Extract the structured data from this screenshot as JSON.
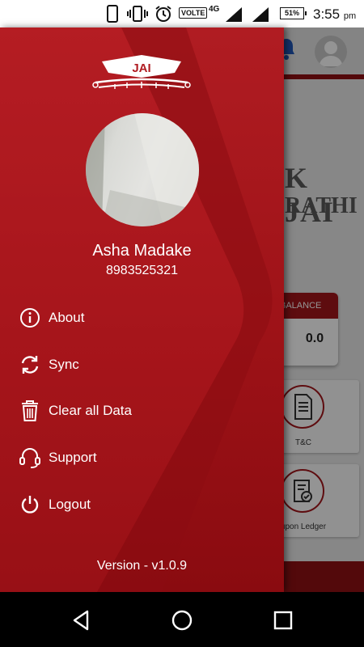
{
  "status_bar": {
    "volte": "VOLTE",
    "network": "4G",
    "battery": "51%",
    "time": "3:55",
    "ampm": "pm",
    "icons": [
      "phone-icon",
      "vibrate-icon",
      "alarm-icon",
      "signal-icon",
      "signal-icon-2"
    ]
  },
  "background_app": {
    "brand_line1": "K JAI",
    "brand_line2": "RATHI",
    "balance_label": "BALANCE",
    "balance_value": "0.0",
    "tiles": [
      {
        "label": "T&C",
        "icon": "document-icon"
      },
      {
        "label": "upon Ledger",
        "icon": "ledger-check-icon"
      }
    ]
  },
  "drawer": {
    "logo_text": "JAI",
    "user": {
      "name": "Asha Madake",
      "phone": "8983525321"
    },
    "menu": [
      {
        "label": "About",
        "icon": "info-icon"
      },
      {
        "label": "Sync",
        "icon": "sync-icon"
      },
      {
        "label": "Clear all Data",
        "icon": "trash-icon"
      },
      {
        "label": "Support",
        "icon": "headset-icon"
      },
      {
        "label": "Logout",
        "icon": "power-icon"
      }
    ],
    "version": "Version - v1.0.9"
  },
  "colors": {
    "drawer_red": "#a8171d",
    "drawer_red_dark": "#8a0b10",
    "text": "#ffffff"
  },
  "nav_bar": {
    "buttons": [
      "back-icon",
      "home-icon",
      "recents-icon"
    ]
  }
}
